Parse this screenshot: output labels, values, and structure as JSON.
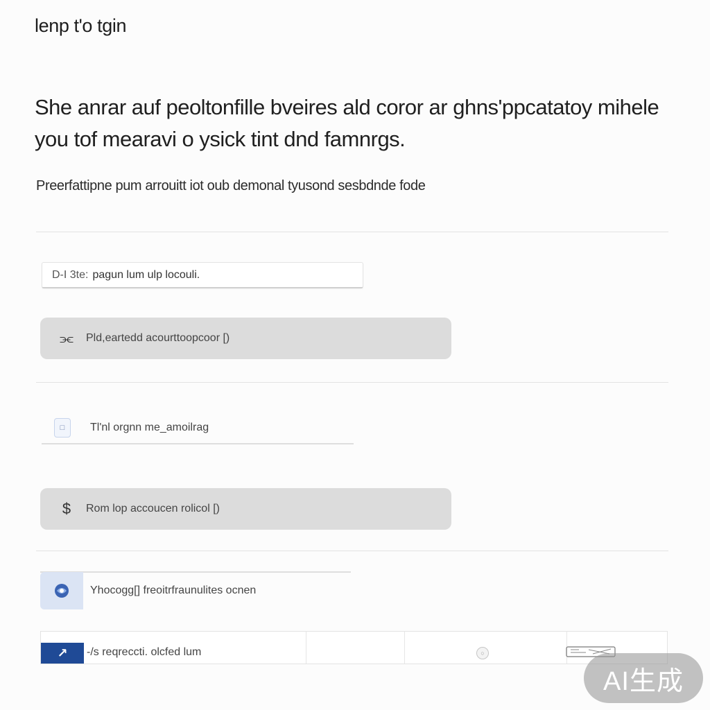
{
  "header": {
    "app_title": "lenp t'o tgin",
    "headline": "She anrar auf peoltonfille bveires ald coror ar ghns'ppcatatoy mihele you tof mearavi o ysick tint dnd famnrgs.",
    "subtitle": "Preerfattipne pum arrouitt iot oub demonal tyusond sesbdnde fode"
  },
  "form": {
    "text_field": {
      "prefix": "D-I 3te:",
      "value": "pagun lum ulp locouli."
    },
    "primary_option": {
      "icon": "key-icon",
      "label": "Pld,eartedd acourttoopcoor [)"
    },
    "email_option": {
      "icon": "square-icon",
      "label": "Tl'nl orgnn me_amoilrag"
    },
    "account_option": {
      "icon": "dollar-icon",
      "label": "Rom lop accoucen rolicol [)"
    },
    "provider_option": {
      "icon": "globe-icon",
      "label": "Yhocogg[] freoitrfraunulites ocnen"
    }
  },
  "footer_bar": {
    "badge_icon": "arrow-icon",
    "text": "-/s reqreccti. olcfed lum",
    "status_icon": "circle-icon",
    "stamp_icon": "stamp-icon"
  },
  "watermark": "AI生成",
  "colors": {
    "accent": "#1f4a96",
    "button_bg": "#dcdcdc",
    "provider_tile": "#dbe4f4"
  }
}
